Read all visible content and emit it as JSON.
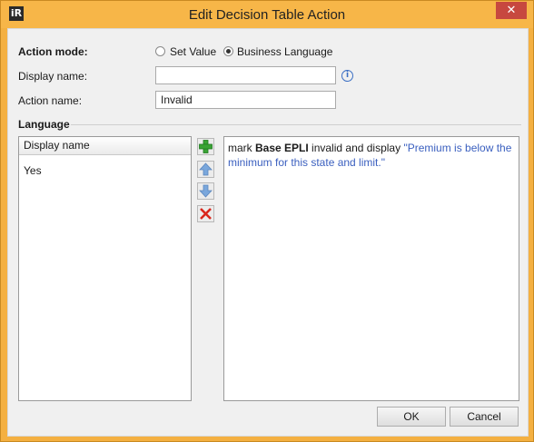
{
  "window": {
    "title": "Edit Decision Table Action",
    "app_icon_text": "iR",
    "close_glyph": "✕"
  },
  "form": {
    "action_mode_label": "Action mode:",
    "mode_options": [
      {
        "label": "Set Value",
        "selected": false
      },
      {
        "label": "Business Language",
        "selected": true
      }
    ],
    "display_name_label": "Display name:",
    "display_name_value": "",
    "action_name_label": "Action name:",
    "action_name_value": "Invalid"
  },
  "language": {
    "section_label": "Language",
    "list_header": "Display name",
    "rows": [
      "Yes"
    ],
    "editor": {
      "prefix": "mark ",
      "bold": "Base EPLI",
      "middle": " invalid and display ",
      "quoted": "\"Premium is below the minimum for this state and limit.\""
    }
  },
  "buttons": {
    "ok": "OK",
    "cancel": "Cancel"
  },
  "colors": {
    "titlebar": "#f7b648",
    "close": "#c7483f",
    "quoted_text": "#3a5fbf",
    "add_icon": "#3aa335",
    "arrow_icon": "#7aa7dc",
    "delete_icon": "#d9261c"
  }
}
